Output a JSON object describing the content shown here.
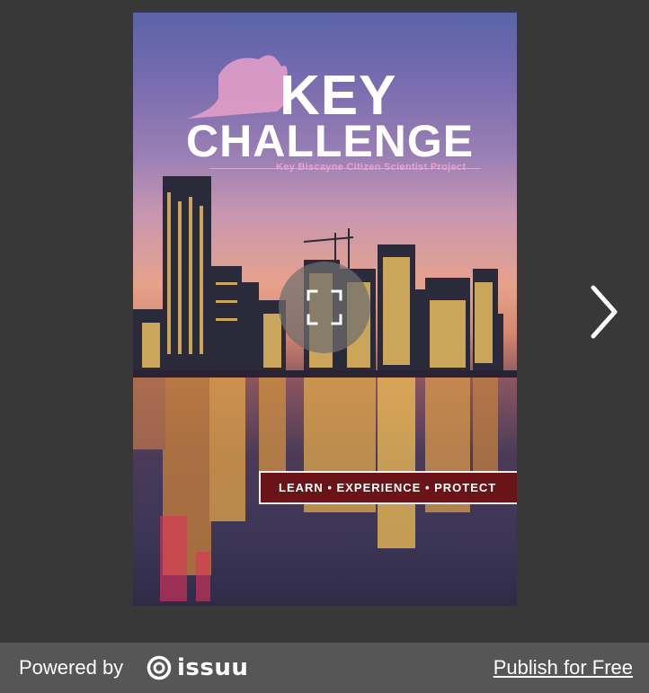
{
  "cover": {
    "title_line1": "KEY",
    "title_line2": "CHALLENGE",
    "subtitle": "Key Biscayne Citizen Scientist Project",
    "banner": "LEARN • EXPERIENCE • PROTECT"
  },
  "controls": {
    "fullscreen_icon": "fullscreen-icon",
    "next_icon": "chevron-right-icon"
  },
  "footer": {
    "powered_by": "Powered by",
    "brand": "issuu",
    "publish_link": "Publish for Free"
  },
  "colors": {
    "viewer_bg": "#383838",
    "footer_bg": "#565656",
    "banner_bg": "#6a1417",
    "subtitle_pink": "#e8a2cc"
  }
}
